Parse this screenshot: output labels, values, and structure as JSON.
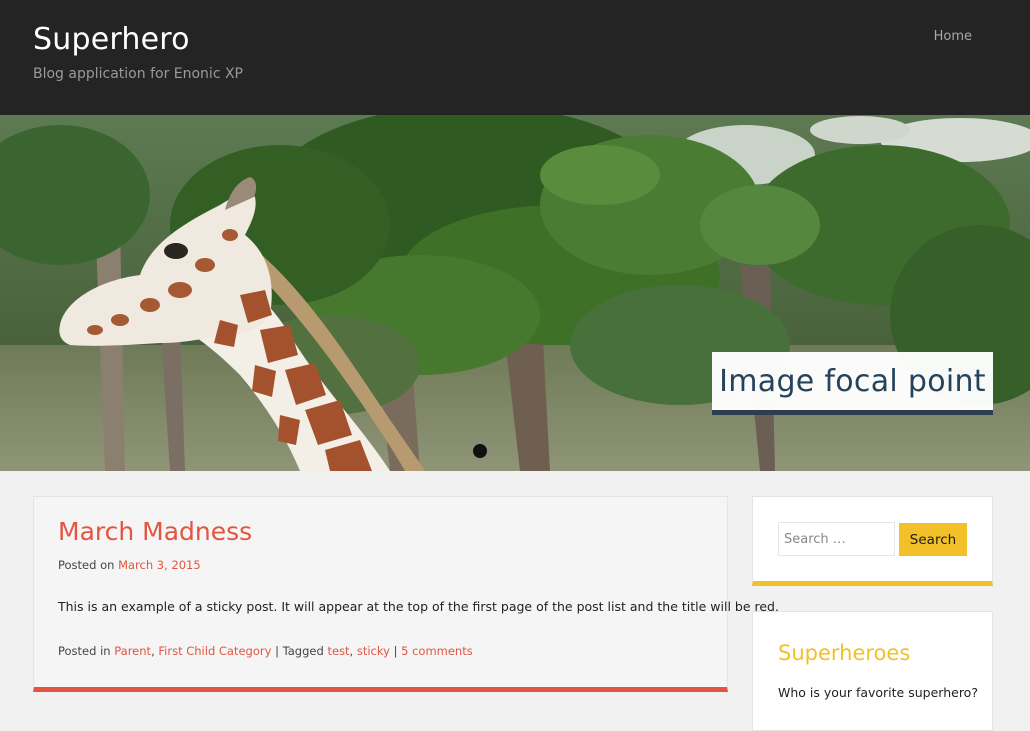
{
  "header": {
    "site_title": "Superhero",
    "site_description": "Blog application for Enonic XP",
    "nav": {
      "home_label": "Home"
    }
  },
  "hero": {
    "image_subject": "giraffe in front of trees",
    "caption": "Image focal point",
    "slides_count": 1,
    "active_slide": 1
  },
  "post": {
    "title": "March Madness",
    "posted_on_label": "Posted on",
    "date": "March 3, 2015",
    "excerpt": "This is an example of a sticky post. It will appear at the top of the first page of the post list and the title will be red.",
    "posted_in_label": "Posted in",
    "categories": [
      "Parent",
      "First Child Category"
    ],
    "tagged_label": "Tagged",
    "tags": [
      "test",
      "sticky"
    ],
    "comments_label": "5 comments",
    "separator": "|",
    "list_separator": ","
  },
  "sidebar": {
    "search": {
      "placeholder": "Search …",
      "button_label": "Search"
    },
    "heroes_widget": {
      "title": "Superheroes",
      "text": "Who is your favorite superhero?"
    }
  },
  "colors": {
    "accent_red": "#e25541",
    "accent_yellow": "#f2c029",
    "header_bg": "#242424",
    "focal_text": "#26435c"
  }
}
